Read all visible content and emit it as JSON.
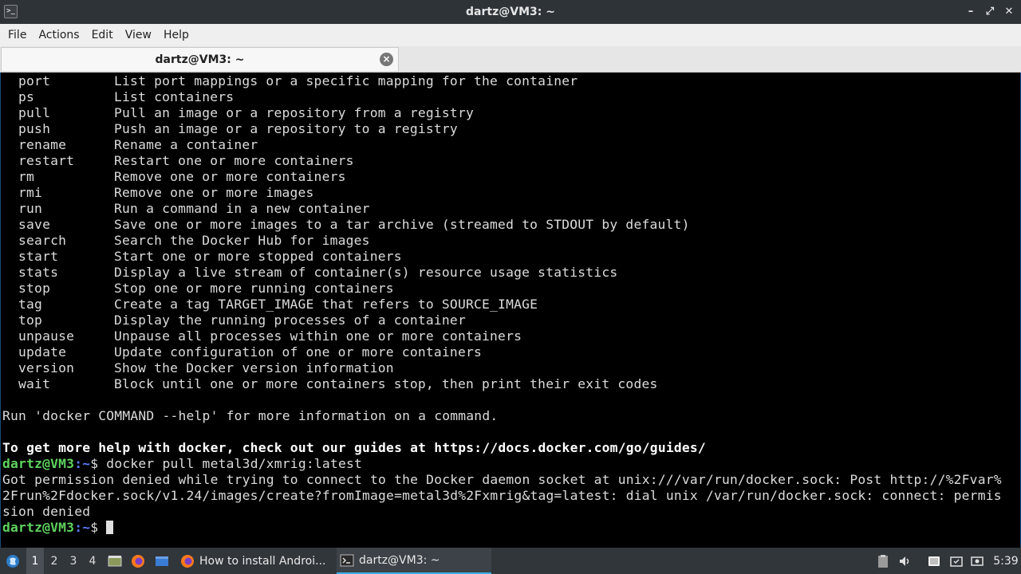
{
  "window": {
    "title": "dartz@VM3: ~",
    "app_icon": ">_",
    "controls": [
      "–",
      "⤢",
      "✕"
    ]
  },
  "menubar": {
    "items": [
      "File",
      "Actions",
      "Edit",
      "View",
      "Help"
    ]
  },
  "tabs": [
    {
      "label": "dartz@VM3: ~",
      "close_icon": "close-icon"
    }
  ],
  "terminal": {
    "commands": [
      {
        "name": "port",
        "desc": "List port mappings or a specific mapping for the container"
      },
      {
        "name": "ps",
        "desc": "List containers"
      },
      {
        "name": "pull",
        "desc": "Pull an image or a repository from a registry"
      },
      {
        "name": "push",
        "desc": "Push an image or a repository to a registry"
      },
      {
        "name": "rename",
        "desc": "Rename a container"
      },
      {
        "name": "restart",
        "desc": "Restart one or more containers"
      },
      {
        "name": "rm",
        "desc": "Remove one or more containers"
      },
      {
        "name": "rmi",
        "desc": "Remove one or more images"
      },
      {
        "name": "run",
        "desc": "Run a command in a new container"
      },
      {
        "name": "save",
        "desc": "Save one or more images to a tar archive (streamed to STDOUT by default)"
      },
      {
        "name": "search",
        "desc": "Search the Docker Hub for images"
      },
      {
        "name": "start",
        "desc": "Start one or more stopped containers"
      },
      {
        "name": "stats",
        "desc": "Display a live stream of container(s) resource usage statistics"
      },
      {
        "name": "stop",
        "desc": "Stop one or more running containers"
      },
      {
        "name": "tag",
        "desc": "Create a tag TARGET_IMAGE that refers to SOURCE_IMAGE"
      },
      {
        "name": "top",
        "desc": "Display the running processes of a container"
      },
      {
        "name": "unpause",
        "desc": "Unpause all processes within one or more containers"
      },
      {
        "name": "update",
        "desc": "Update configuration of one or more containers"
      },
      {
        "name": "version",
        "desc": "Show the Docker version information"
      },
      {
        "name": "wait",
        "desc": "Block until one or more containers stop, then print their exit codes"
      }
    ],
    "help_line": "Run 'docker COMMAND --help' for more information on a command.",
    "guides_line": "To get more help with docker, check out our guides at https://docs.docker.com/go/guides/",
    "prompt_user": "dartz@VM3",
    "prompt_path": ":~",
    "prompt_symbol": "$ ",
    "last_command": "docker pull metal3d/xmrig:latest",
    "error_lines": [
      "Got permission denied while trying to connect to the Docker daemon socket at unix:///var/run/docker.sock: Post http://%2Fvar%",
      "2Frun%2Fdocker.sock/v1.24/images/create?fromImage=metal3d%2Fxmrig&tag=latest: dial unix /var/run/docker.sock: connect: permis",
      "sion denied"
    ]
  },
  "taskbar": {
    "start_icon": "start-menu-icon",
    "workspaces": [
      "1",
      "2",
      "3",
      "4"
    ],
    "active_workspace": "1",
    "launchers": [
      "show-desktop-icon",
      "firefox-icon",
      "file-manager-icon"
    ],
    "tasks": [
      {
        "label": "How to install Androi...",
        "icon": "firefox-icon"
      },
      {
        "label": "dartz@VM3: ~",
        "icon": "terminal-icon"
      }
    ],
    "tray": [
      "clipboard-icon",
      "volume-icon",
      "display-icon",
      "files-icon",
      "screenshot-icon",
      "network-icon"
    ],
    "clock": "5:39"
  }
}
